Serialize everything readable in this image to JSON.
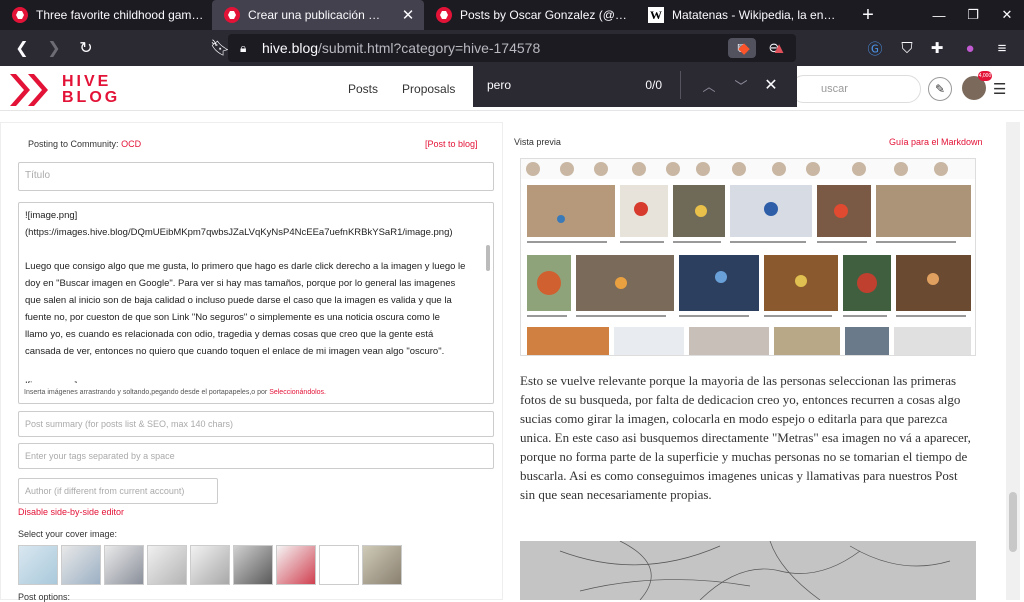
{
  "browser": {
    "tabs": [
      {
        "title": "Three favorite childhood games (W",
        "icon": "hive-icon",
        "active": false
      },
      {
        "title": "Crear una publicación — Hive",
        "icon": "hive-icon",
        "active": true
      },
      {
        "title": "Posts by Oscar Gonzalez (@random",
        "icon": "hive-icon",
        "active": false
      },
      {
        "title": "Matatenas - Wikipedia, la enciclope",
        "icon": "wikipedia-icon",
        "active": false
      }
    ],
    "url_host": "hive.blog",
    "url_path": "/submit.html?category=hive-174578",
    "find": {
      "query": "pero",
      "count": "0/0"
    }
  },
  "site": {
    "logo_top": "HIVE",
    "logo_bottom": "BLOG",
    "nav": [
      "Posts",
      "Proposals",
      "W"
    ],
    "search_placeholder": "uscar",
    "notif_badge": "4,000"
  },
  "editor": {
    "posting_to_label": "Posting to Community:",
    "community": "OCD",
    "post_to_blog": "[Post to blog]",
    "title_placeholder": "Título",
    "body_lines": [
      "![image.png]",
      "(https://images.hive.blog/DQmUEibMKpm7qwbsJZaLVqKyNsP4NcEEa7uefnKRBkYSaR1/image.png)",
      "",
      "Luego que consigo algo que me gusta, lo primero que hago es darle click derecho a la imagen y luego le",
      "doy en \"Buscar imagen en Google\". Para ver si hay mas tamaños, porque por lo general las imagenes",
      "que salen al inicio son de baja calidad o incluso puede darse el caso que la imagen es valida y que la",
      "fuente no, por cueston de que son Link \"No seguros\" o simplemente es una noticia oscura como le",
      "llamo yo, es cuando es relacionada con odio, tragedia y demas cosas que creo que la gente está",
      "cansada de ver, entonces no quiero que cuando toquen el enlace de mi imagen vean algo \"oscuro\".",
      "",
      "![image.png]"
    ],
    "upload_hint": "Inserta imágenes arrastrando y soltando,pegando desde el portapapeles,o por",
    "upload_link": "Seleccionándolos.",
    "summary_placeholder": "Post summary (for posts list & SEO, max 140 chars)",
    "tags_placeholder": "Enter your tags separated by a space",
    "author_placeholder": "Author (if different from current account)",
    "disable_editor": "Disable side-by-side editor",
    "cover_label": "Select your cover image:",
    "bottom_label": "Post options:"
  },
  "preview": {
    "label": "Vista previa",
    "markdown_guide": "Guía para el Markdown",
    "paragraph": "Esto se vuelve relevante porque la mayoria de las personas seleccionan las primeras fotos de su busqueda, por falta de dedicacion creo yo, entonces recurren a cosas algo sucias como girar la imagen, colocarla en modo espejo o editarla para que parezca unica. En este caso asi busquemos directamente \"Metras\" esa imagen no vá a aparecer, porque no forma parte de la superficie y muchas personas no se tomarian el tiempo de buscarla. Asi es como conseguimos imagenes unicas y llamativas para nuestros Post sin que sean necesariamente propias.",
    "thumb_captions_row1": [
      "Las Metras: un juego que le Guardó en la Memoria...",
      "Metras Sueltas de 31 Gr...",
      "DERECHO Y DESARROLLO ...",
      "Qué son las metras venezolanas? - Banger News",
      "El Juego de Metras: Historia y ...",
      "Pombo, Canicas, Metras... ~ Steemit"
    ],
    "thumb_captions_row2": [
      "Metras, juego del que si no Metras...",
      "Cómo se hacen las metras? - Quora",
      "Metras - Juego Popular - Steemit",
      "Juegos tradicionales de Venezuela...",
      "Metras de la vida -- ABIOLUT...",
      "Arriba la imagen Adolescentes Lucy..."
    ]
  },
  "colors": {
    "brand": "#e31337",
    "tab_bg": "#1c1b22",
    "nav_bg": "#2b2a33"
  }
}
